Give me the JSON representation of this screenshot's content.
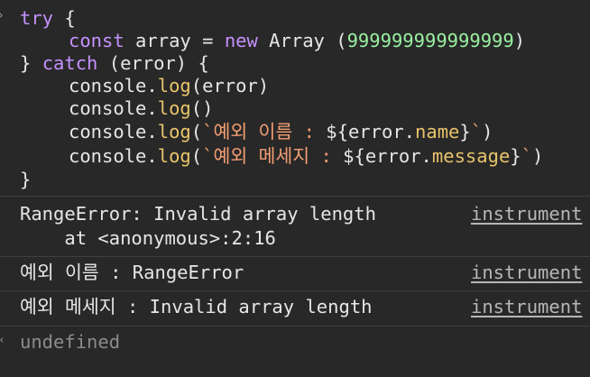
{
  "code": {
    "l1": {
      "kw": "try",
      "rest": " {"
    },
    "l2": {
      "kw1": "const",
      "ident": " array = ",
      "kw2": "new",
      "cls": " Array (",
      "num": "999999999999999",
      "close": ")"
    },
    "l3": {
      "open": "} ",
      "kw": "catch",
      "rest": " (error) {"
    },
    "l4": {
      "obj": "console.",
      "fn": "log",
      "args": "(error)"
    },
    "l5": {
      "obj": "console.",
      "fn": "log",
      "args": "()"
    },
    "l6": {
      "obj": "console.",
      "fn": "log",
      "paren": "(",
      "str": "`예외 이름 : ",
      "interp_open": "${error.",
      "prop": "name",
      "interp_close": "}",
      "str_end": "`",
      "close": ")"
    },
    "l7": {
      "obj": "console.",
      "fn": "log",
      "paren": "(",
      "str": "`예외 메세지 : ",
      "interp_open": "${error.",
      "prop": "message",
      "interp_close": "}",
      "str_end": "`",
      "close": ")"
    },
    "l8": {
      "text": "}"
    }
  },
  "output": {
    "error": {
      "line1": "RangeError: Invalid array length",
      "line2": "    at <anonymous>:2:16",
      "source": "instrument"
    },
    "name_line": {
      "text": "예외 이름 : RangeError",
      "source": "instrument"
    },
    "message_line": {
      "text": "예외 메세지 : Invalid array length",
      "source": "instrument"
    },
    "result": "undefined"
  },
  "icons": {
    "prompt": "chevron-right-icon",
    "result": "chevron-left-icon"
  },
  "colors": {
    "background": "#282828",
    "keyword": "#c491fd",
    "number": "#99f1a1",
    "string": "#f39e72",
    "function": "#e8c46a"
  }
}
